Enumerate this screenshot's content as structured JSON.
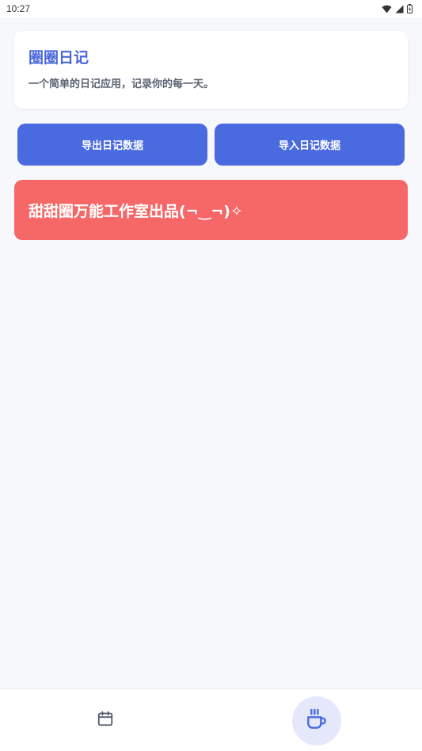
{
  "status_bar": {
    "time": "10:27",
    "icons": [
      "wifi-icon",
      "signal-icon",
      "battery-icon"
    ]
  },
  "header": {
    "title": "圈圈日记",
    "subtitle": "一个简单的日记应用，记录你的每一天。"
  },
  "actions": {
    "export_label": "导出日记数据",
    "import_label": "导入日记数据"
  },
  "banner": {
    "text": "甜甜圈万能工作室出品(¬‿¬)✧"
  },
  "bottom_nav": {
    "items": [
      {
        "icon": "calendar-icon",
        "active": false
      },
      {
        "icon": "coffee-cup-icon",
        "active": true
      }
    ]
  },
  "colors": {
    "accent": "#4a6ae0",
    "title": "#4a67d9",
    "banner": "#f66767",
    "background": "#f7f8fb",
    "active_nav_bg": "#e4e8fa"
  }
}
